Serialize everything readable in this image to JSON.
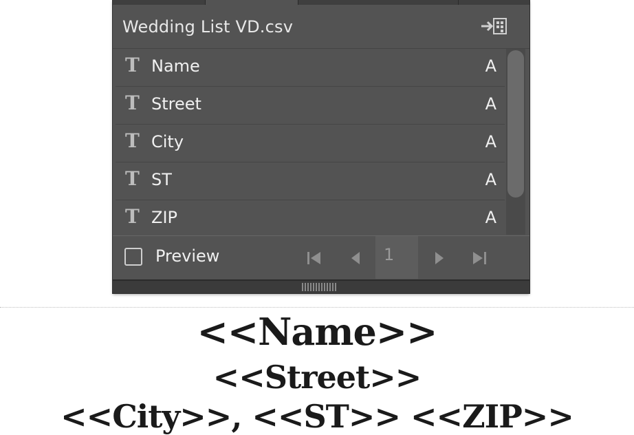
{
  "panel": {
    "source_name": "Wedding List VD.csv",
    "import_icon": "import-data-source-icon",
    "fields": [
      {
        "icon": "text-field-icon",
        "name": "Name",
        "flag": "A"
      },
      {
        "icon": "text-field-icon",
        "name": "Street",
        "flag": "A"
      },
      {
        "icon": "text-field-icon",
        "name": "City",
        "flag": "A"
      },
      {
        "icon": "text-field-icon",
        "name": "ST",
        "flag": "A"
      },
      {
        "icon": "text-field-icon",
        "name": "ZIP",
        "flag": "A"
      }
    ],
    "field_type_glyph": "T",
    "footer": {
      "preview_label": "Preview",
      "preview_checked": false,
      "record_number": "1"
    }
  },
  "document": {
    "line1": "<<Name>>",
    "line2": "<<Street>>",
    "line3": "<<City>>, <<ST>> <<ZIP>>"
  },
  "colors": {
    "panel_bg": "#535353",
    "text": "#f0f0f0",
    "icon": "#bdbdbd"
  }
}
